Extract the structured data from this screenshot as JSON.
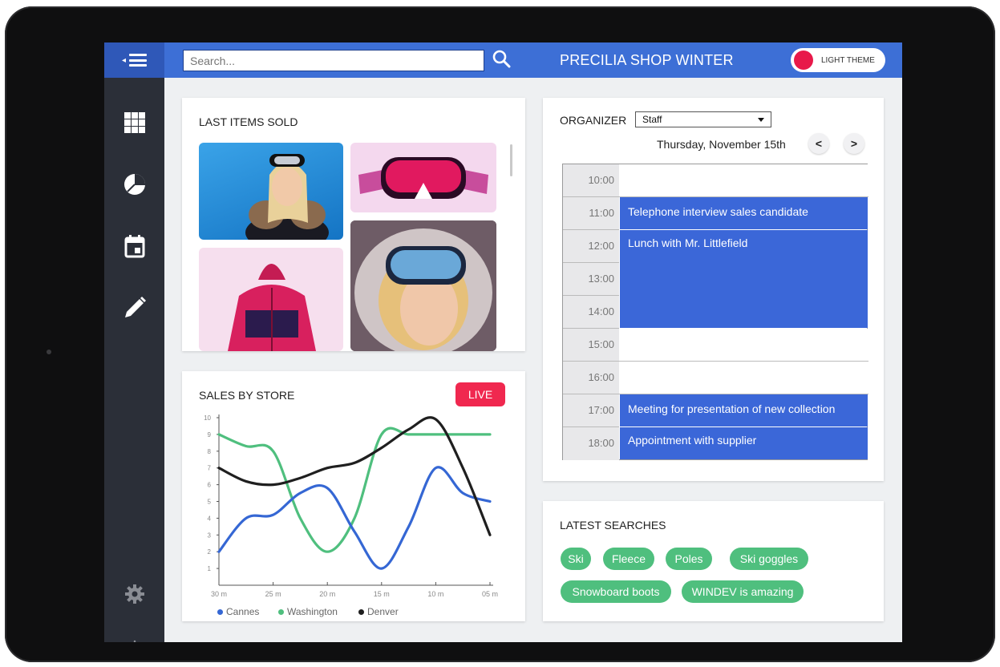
{
  "header": {
    "search_placeholder": "Search...",
    "app_title": "PRECILIA SHOP WINTER",
    "theme_label": "LIGHT THEME"
  },
  "sidebar": {
    "items": [
      {
        "icon": "grid-icon"
      },
      {
        "icon": "pie-chart-icon"
      },
      {
        "icon": "calendar-icon"
      },
      {
        "icon": "pencil-icon"
      },
      {
        "icon": "gear-icon"
      },
      {
        "icon": "power-icon"
      }
    ]
  },
  "last_items": {
    "title": "LAST ITEMS SOLD",
    "items": [
      "skier-woman-photo",
      "pink-goggles-photo",
      "pink-jacket-photo",
      "girl-goggles-photo"
    ]
  },
  "sales": {
    "title": "SALES BY STORE",
    "live_label": "LIVE"
  },
  "chart_data": {
    "type": "line",
    "title": "SALES BY STORE",
    "x": [
      "30 m",
      "25 m",
      "20 m",
      "15 m",
      "10 m",
      "05 m"
    ],
    "ylim": [
      0,
      10
    ],
    "yticks": [
      "1",
      "2",
      "3",
      "4",
      "5",
      "6",
      "7",
      "8",
      "9",
      "10"
    ],
    "series": [
      {
        "name": "Cannes",
        "color": "#3567d4",
        "x": [
          30,
          27.5,
          25,
          22.5,
          20,
          17.5,
          15,
          12.5,
          10,
          7.5,
          5
        ],
        "values": [
          2,
          4,
          4.2,
          5.5,
          5.8,
          3.2,
          1.0,
          3.5,
          7.0,
          5.5,
          5.0
        ]
      },
      {
        "name": "Washington",
        "color": "#4fbf7e",
        "x": [
          30,
          27.5,
          25,
          22.5,
          20,
          17.5,
          15,
          12.5,
          10,
          7.5,
          5
        ],
        "values": [
          9,
          8.3,
          8,
          4,
          2.0,
          4,
          9,
          9,
          9,
          9,
          9
        ]
      },
      {
        "name": "Denver",
        "color": "#1f1f1f",
        "x": [
          30,
          27.5,
          25,
          22.5,
          20,
          17.5,
          15,
          12.5,
          10,
          7.5,
          5
        ],
        "values": [
          7,
          6.2,
          6.0,
          6.4,
          7.0,
          7.3,
          8.2,
          9.3,
          9.9,
          7.0,
          3.0
        ]
      }
    ],
    "grid": false,
    "legend": "bottom"
  },
  "organizer": {
    "title": "ORGANIZER",
    "filter_value": "Staff",
    "date": "Thursday, November 15th",
    "prev_label": "<",
    "next_label": ">",
    "hours": [
      "10:00",
      "11:00",
      "12:00",
      "13:00",
      "14:00",
      "15:00",
      "16:00",
      "17:00",
      "18:00"
    ],
    "events": [
      {
        "title": "Telephone interview sales candidate",
        "start": "11:00",
        "end": "12:00"
      },
      {
        "title": "Lunch with Mr. Littlefield",
        "start": "12:00",
        "end": "15:00"
      },
      {
        "title": "Meeting for presentation of new collection",
        "start": "17:00",
        "end": "18:00"
      },
      {
        "title": "Appointment with supplier",
        "start": "18:00",
        "end": "19:00"
      }
    ]
  },
  "latest_searches": {
    "title": "LATEST SEARCHES",
    "tags": [
      "Ski",
      "Fleece",
      "Poles",
      "Ski goggles",
      "Snowboard boots",
      "WINDEV is amazing"
    ]
  },
  "colors": {
    "accent": "#3d6fd6",
    "sidebar": "#2b2f38",
    "live": "#f0284f",
    "tag": "#4fbf7e",
    "event": "#3b67d8"
  }
}
